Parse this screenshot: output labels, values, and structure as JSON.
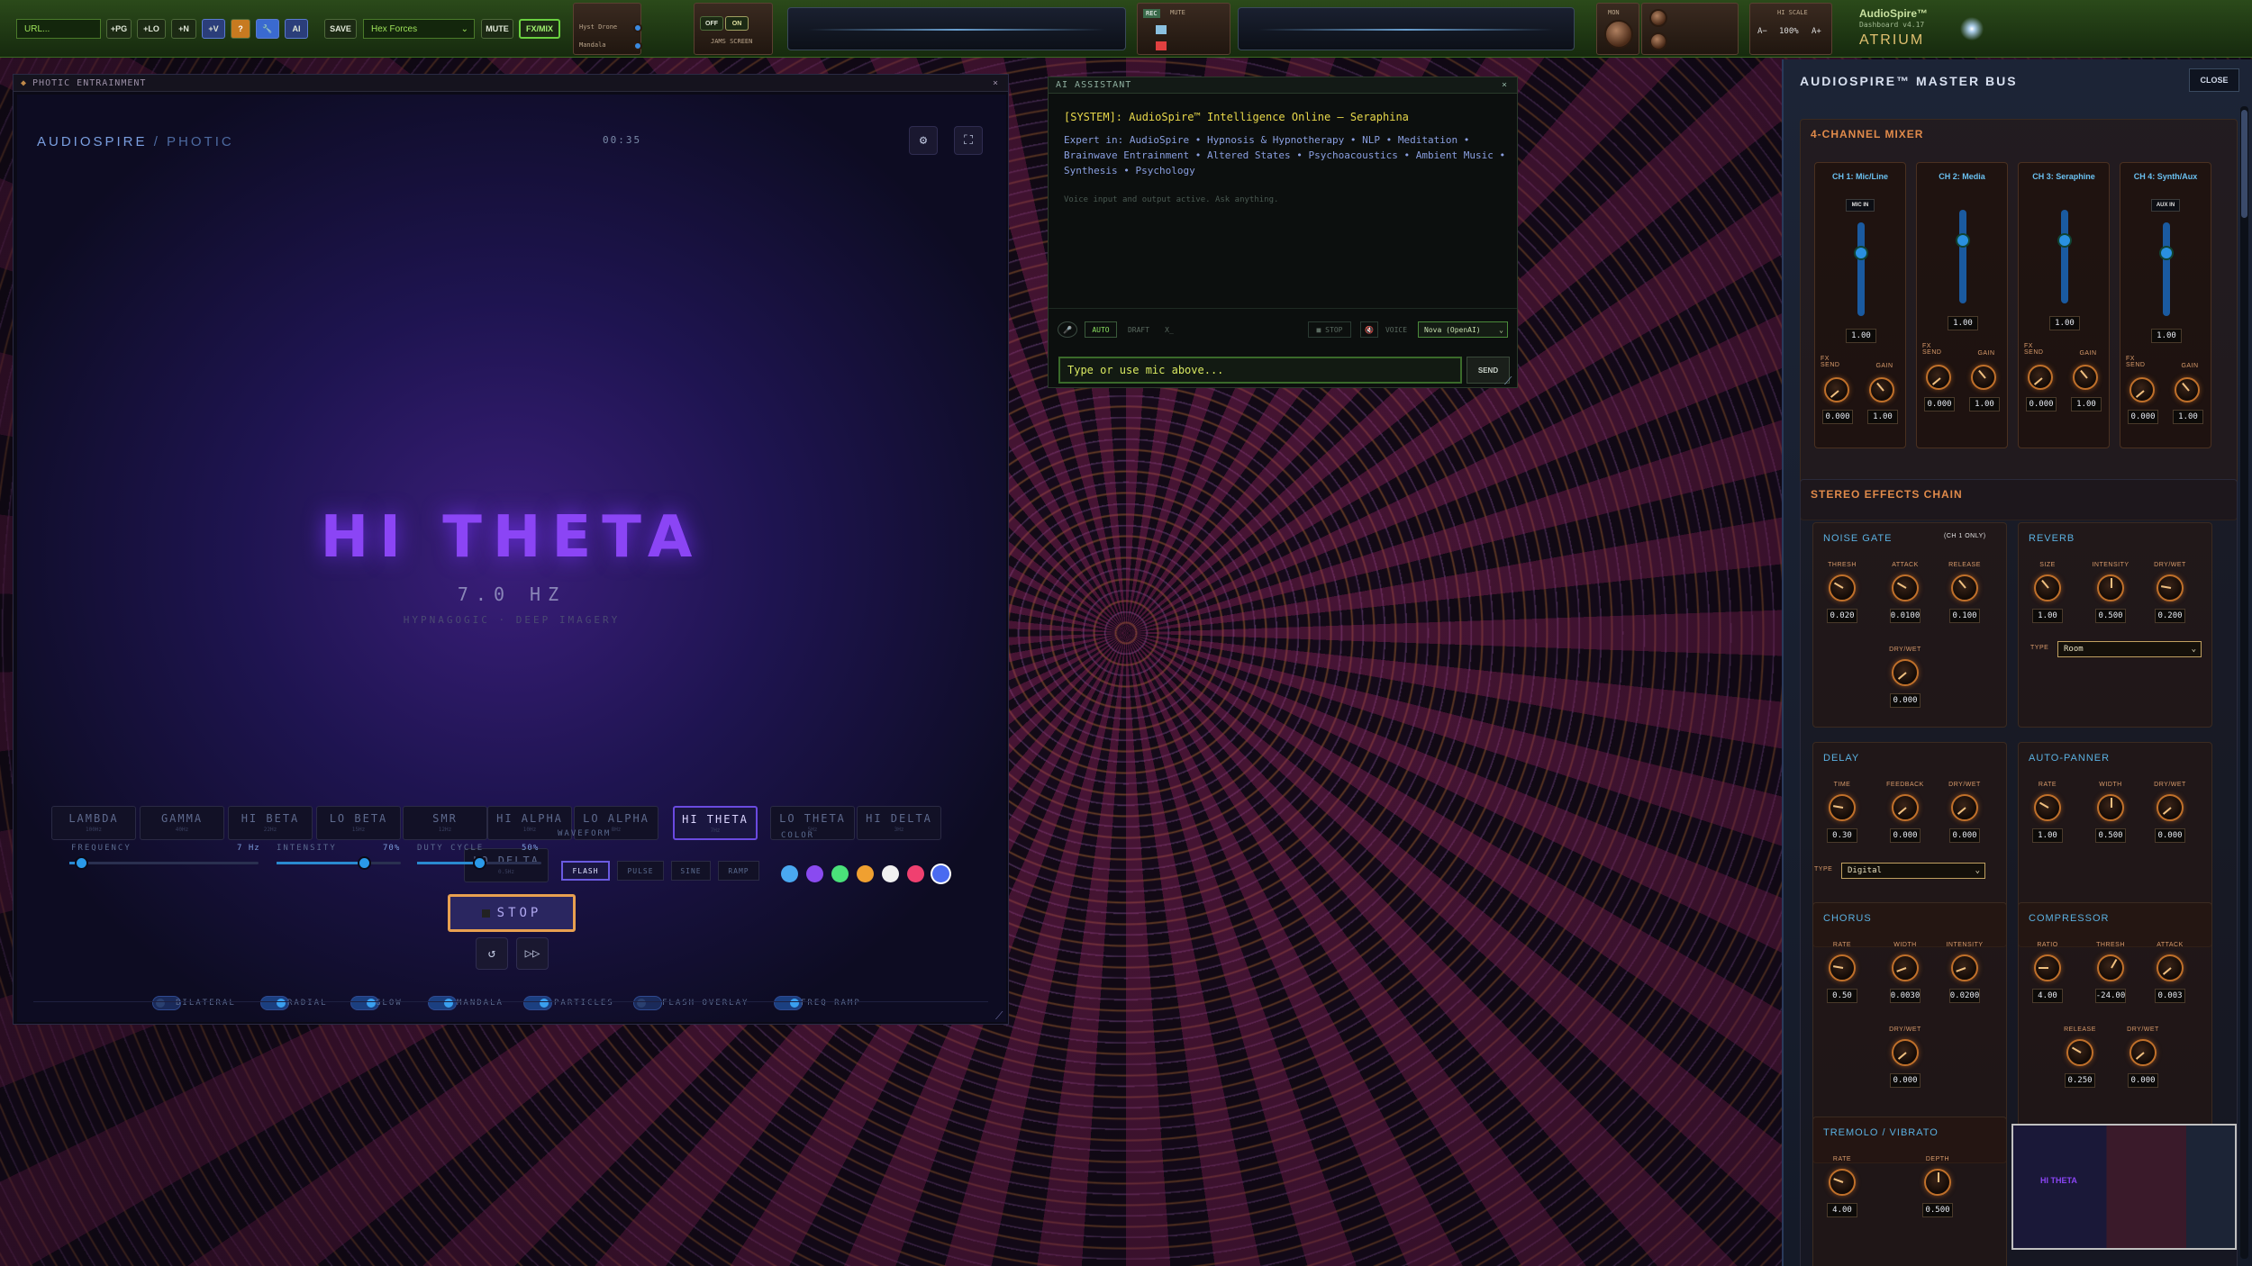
{
  "topbar": {
    "url_placeholder": "URL...",
    "pg": "+PG",
    "lo": "+LO",
    "n": "+N",
    "v": "+V",
    "q": "?",
    "ai": "AI",
    "save": "SAVE",
    "preset": "Hex Forces",
    "mute": "MUTE",
    "fxmix": "FX/MIX",
    "ch_a": "Hyst Drone",
    "ch_b": "Mandala",
    "off": "OFF",
    "on": "ON",
    "mini_label": "JAMS SCREEN",
    "rec": "REC",
    "mute2": "MUTE",
    "mon": "MON",
    "hi_scale": "HI SCALE",
    "zoom_out": "A−",
    "zoom": "100%",
    "zoom_in": "A+",
    "app_name": "AudioSpire™",
    "app_version": "Dashboard v4.17",
    "app_logo": "ATRIUM"
  },
  "photic": {
    "window_title": "PHOTIC ENTRAINMENT",
    "brand": "AUDIOSPIRE",
    "brand_sub": "/ PHOTIC",
    "timer": "00:35",
    "state_title": "HI THETA",
    "state_hz": "7.0 HZ",
    "state_desc": "HYPNAGOGIC · DEEP IMAGERY",
    "bands": [
      {
        "label": "LAMBDA",
        "sub": "100Hz"
      },
      {
        "label": "GAMMA",
        "sub": "40Hz"
      },
      {
        "label": "HI BETA",
        "sub": "22Hz"
      },
      {
        "label": "LO BETA",
        "sub": "15Hz"
      },
      {
        "label": "SMR",
        "sub": "12Hz"
      },
      {
        "label": "HI ALPHA",
        "sub": "10Hz"
      },
      {
        "label": "LO ALPHA",
        "sub": "8Hz"
      },
      {
        "label": "HI THETA",
        "sub": "7Hz"
      },
      {
        "label": "LO THETA",
        "sub": "5Hz"
      },
      {
        "label": "HI DELTA",
        "sub": "3Hz"
      },
      {
        "label": "LO DELTA",
        "sub": "0.5Hz"
      }
    ],
    "frequency_label": "FREQUENCY",
    "frequency_value": "7 Hz",
    "frequency_level": 0.06,
    "intensity_label": "INTENSITY",
    "intensity_value": "70%",
    "intensity_level": 0.7,
    "duty_label": "DUTY CYCLE",
    "duty_value": "50%",
    "duty_level": 0.5,
    "waveform_label": "WAVEFORM",
    "waveforms": [
      "FLASH",
      "PULSE",
      "SINE",
      "RAMP"
    ],
    "color_label": "COLOR",
    "colors": [
      "#4aa8f0",
      "#8a4af0",
      "#4ae07a",
      "#f0a030",
      "#f0f0f0",
      "#f04070",
      "#4a6af0"
    ],
    "stop": "STOP",
    "reset_icon": "↺",
    "skip_icon": "▷▷",
    "toggles": [
      {
        "label": "BILATERAL",
        "on": false
      },
      {
        "label": "RADIAL",
        "on": true
      },
      {
        "label": "GLOW",
        "on": true
      },
      {
        "label": "MANDALA",
        "on": true
      },
      {
        "label": "PARTICLES",
        "on": true
      },
      {
        "label": "FLASH OVERLAY",
        "on": false
      },
      {
        "label": "FREQ RAMP",
        "on": true
      }
    ]
  },
  "ai": {
    "window_title": "AI ASSISTANT",
    "system": "[SYSTEM]: AudioSpire™ Intelligence Online — Seraphina",
    "expertise": "Expert in: AudioSpire • Hypnosis & Hypnotherapy • NLP • Meditation • Brainwave Entrainment • Altered States • Psychoacoustics • Ambient Music • Synthesis • Psychology",
    "hint": "Voice input and output active. Ask anything.",
    "auto": "AUTO",
    "draft": "DRAFT",
    "x": "X_",
    "stop": "■ STOP",
    "voice_label": "VOICE",
    "voice": "Nova (OpenAI)",
    "input_placeholder": "Type or use mic above...",
    "send": "SEND"
  },
  "master": {
    "title": "AUDIOSPIRE™ MASTER BUS",
    "close": "CLOSE",
    "mixer_title": "4-CHANNEL MIXER",
    "channels": [
      {
        "name": "CH 1: Mic/Line",
        "badge": "MIC IN",
        "level": "1.00",
        "fx": "0.000",
        "gain": "1.00"
      },
      {
        "name": "CH 2: Media",
        "badge": "",
        "level": "1.00",
        "fx": "0.000",
        "gain": "1.00"
      },
      {
        "name": "CH 3: Seraphine",
        "badge": "",
        "level": "1.00",
        "fx": "0.000",
        "gain": "1.00"
      },
      {
        "name": "CH 4: Synth/Aux",
        "badge": "AUX IN",
        "level": "1.00",
        "fx": "0.000",
        "gain": "1.00"
      }
    ],
    "fx_send": "FX SEND",
    "gain": "GAIN",
    "chain_title": "STEREO EFFECTS CHAIN",
    "noise_gate": {
      "title": "NOISE GATE",
      "note": "(CH 1 ONLY)",
      "thresh": "0.020",
      "attack": "0.0100",
      "release": "0.100",
      "drywet": "0.000"
    },
    "reverb": {
      "title": "REVERB",
      "size": "1.00",
      "intensity": "0.500",
      "drywet": "0.200",
      "type_label": "TYPE",
      "type": "Room"
    },
    "delay": {
      "title": "DELAY",
      "time": "0.30",
      "feedback": "0.000",
      "drywet": "0.000",
      "type_label": "TYPE",
      "type": "Digital"
    },
    "autopanner": {
      "title": "AUTO-PANNER",
      "rate": "1.00",
      "width": "0.500",
      "drywet": "0.000"
    },
    "chorus": {
      "title": "CHORUS",
      "rate": "0.50",
      "width": "0.0030",
      "intensity": "0.0200",
      "drywet": "0.000"
    },
    "compressor": {
      "title": "COMPRESSOR",
      "ratio": "4.00",
      "thresh": "-24.00",
      "attack": "0.003",
      "release": "0.250",
      "drywet": "0.000"
    },
    "tremolo": {
      "title": "TREMOLO / VIBRATO",
      "rate": "4.00",
      "depth": "0.500"
    },
    "labels": {
      "thresh": "THRESH",
      "attack": "ATTACK",
      "release": "RELEASE",
      "drywet": "DRY/WET",
      "size": "SIZE",
      "intensity": "INTENSITY",
      "time": "TIME",
      "feedback": "FEEDBACK",
      "rate": "RATE",
      "width": "WIDTH",
      "ratio": "RATIO",
      "depth": "DEPTH"
    }
  }
}
